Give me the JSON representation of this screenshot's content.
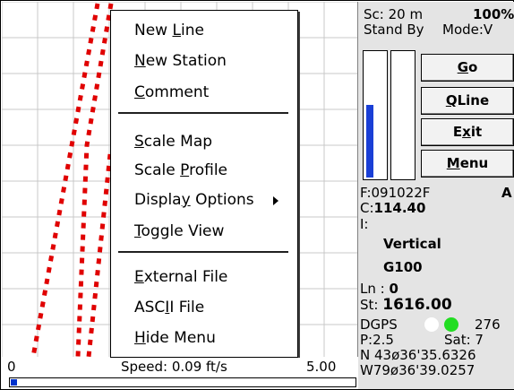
{
  "map": {
    "track_color": "#e00000",
    "grid_color": "#c8c8c8"
  },
  "popup_menu": {
    "items": [
      {
        "pre": "New ",
        "key": "L",
        "post": "ine"
      },
      {
        "pre": "",
        "key": "N",
        "post": "ew Station"
      },
      {
        "pre": "",
        "key": "C",
        "post": "omment"
      },
      {
        "pre": "",
        "key": "S",
        "post": "cale Map"
      },
      {
        "pre": "Scale ",
        "key": "P",
        "post": "rofile"
      },
      {
        "pre": "Displa",
        "key": "y",
        "post": " Options"
      },
      {
        "pre": "",
        "key": "T",
        "post": "oggle View"
      },
      {
        "pre": "",
        "key": "E",
        "post": "xternal File"
      },
      {
        "pre": "ASC",
        "key": "I",
        "post": "I File"
      },
      {
        "pre": "",
        "key": "H",
        "post": "ide Menu"
      }
    ],
    "submenu_item_index": 5
  },
  "speed_bar": {
    "min_label": "0",
    "readout": "Speed: 0.09 ft/s",
    "max_label": "5.00",
    "level": 0.018,
    "fill_color": "#0033cc"
  },
  "panel": {
    "scale_label": "Sc:  20 m",
    "zoom": "100%",
    "status": "Stand By",
    "mode": "Mode:V",
    "bar_left_level": 0.58,
    "bar_right_level": 0.0,
    "buttons": {
      "go": {
        "pre": "",
        "key": "G",
        "post": "o"
      },
      "qline": {
        "pre": "",
        "key": "Q",
        "post": "Line"
      },
      "exit": {
        "pre": "E",
        "key": "x",
        "post": "it"
      },
      "menu": {
        "pre": "",
        "key": "M",
        "post": "enu"
      }
    },
    "file_label": "F:091022F",
    "file_flag": "A",
    "c_prefix": "C:",
    "c_value": "114.40",
    "i_label": "I:",
    "orientation": "Vertical",
    "instrument": "G100",
    "ln_prefix": "Ln : ",
    "ln_value": "0",
    "st_prefix": "St: ",
    "st_value": "1616.00",
    "dgps_label": "DGPS",
    "dgps_value": "276",
    "dot_white": "#ffffff",
    "dot_green": "#22dd22",
    "pdop": "P:2.5",
    "sat": "Sat: 7",
    "lat": "N 43ø36'35.6326",
    "lon": "W79ø36'39.0257"
  }
}
